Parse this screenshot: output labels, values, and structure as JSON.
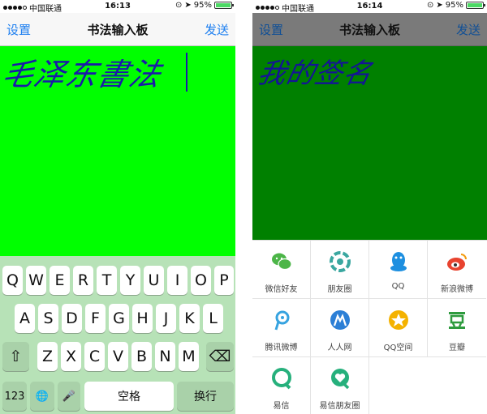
{
  "left": {
    "status": {
      "carrier": "中国联通",
      "time": "16:13",
      "battery": "95%",
      "battery_level": 0.95
    },
    "nav": {
      "left": "设置",
      "title": "书法输入板",
      "right": "发送"
    },
    "canvas": {
      "ink_text": "毛泽东書法",
      "color": "#00ff00",
      "ink_color": "#1a1aa8"
    },
    "keyboard": {
      "row1": [
        "Q",
        "W",
        "E",
        "R",
        "T",
        "Y",
        "U",
        "I",
        "O",
        "P"
      ],
      "row2": [
        "A",
        "S",
        "D",
        "F",
        "G",
        "H",
        "J",
        "K",
        "L"
      ],
      "row3": [
        "Z",
        "X",
        "C",
        "V",
        "B",
        "N",
        "M"
      ],
      "shift_symbol": "⇧",
      "delete_symbol": "⌫",
      "key_123": "123",
      "globe_symbol": "🌐",
      "mic_symbol": "🎤",
      "space": "空格",
      "return": "换行"
    }
  },
  "right": {
    "status": {
      "carrier": "中国联通",
      "time": "16:14",
      "battery": "95%",
      "battery_level": 0.95
    },
    "nav": {
      "left": "设置",
      "title": "书法输入板",
      "right": "发送"
    },
    "canvas": {
      "ink_text": "我的签名",
      "color": "#008000",
      "ink_color": "#1a1aa8"
    },
    "share": {
      "items": [
        {
          "label": "微信好友",
          "icon": "wechat-icon",
          "color": "#4cb548"
        },
        {
          "label": "朋友圈",
          "icon": "moments-icon",
          "color": "#3aa7a0"
        },
        {
          "label": "QQ",
          "icon": "qq-icon",
          "color": "#1d8fe0"
        },
        {
          "label": "新浪微博",
          "icon": "weibo-icon",
          "color": "#e8432f"
        },
        {
          "label": "腾讯微博",
          "icon": "tencent-weibo-icon",
          "color": "#36a3e0"
        },
        {
          "label": "人人网",
          "icon": "renren-icon",
          "color": "#2b7fd6"
        },
        {
          "label": "QQ空间",
          "icon": "qzone-icon",
          "color": "#f4b200"
        },
        {
          "label": "豆瓣",
          "icon": "douban-icon",
          "color": "#2e9b3e"
        },
        {
          "label": "易信",
          "icon": "yixin-icon",
          "color": "#26b07c"
        },
        {
          "label": "易信朋友圈",
          "icon": "yixin-moments-icon",
          "color": "#26b07c"
        }
      ]
    }
  }
}
